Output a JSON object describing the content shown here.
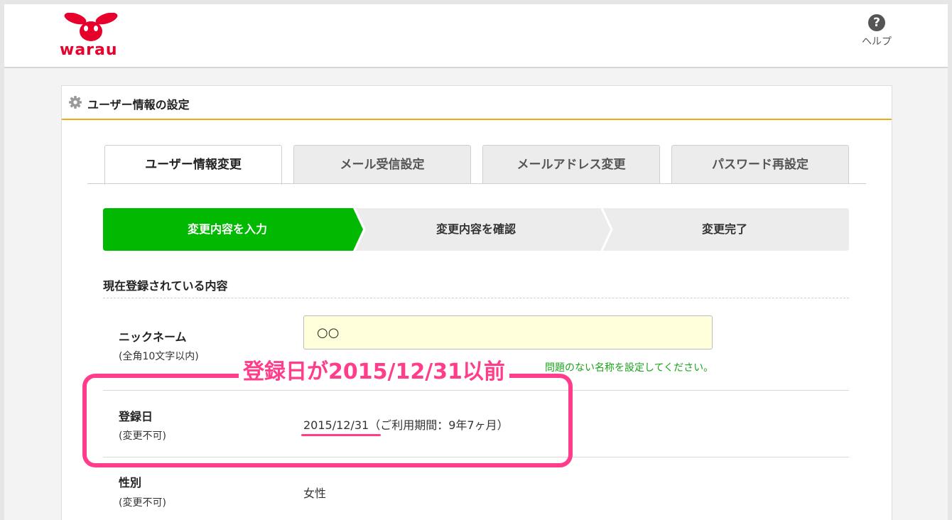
{
  "brand": {
    "name": "warau",
    "color": "#e8002d"
  },
  "help": {
    "icon": "question-icon",
    "label": "ヘルプ"
  },
  "panel": {
    "title": "ユーザー情報の設定",
    "icon": "gear-icon",
    "accent": "#f3a91b"
  },
  "tabs": [
    {
      "label": "ユーザー情報変更",
      "active": true
    },
    {
      "label": "メール受信設定",
      "active": false
    },
    {
      "label": "メールアドレス変更",
      "active": false
    },
    {
      "label": "パスワード再設定",
      "active": false
    }
  ],
  "steps": [
    {
      "label": "変更内容を入力",
      "active": true
    },
    {
      "label": "変更内容を確認",
      "active": false
    },
    {
      "label": "変更完了",
      "active": false
    }
  ],
  "step_active_color": "#00b900",
  "section": {
    "title": "現在登録されている内容"
  },
  "nickname": {
    "label": "ニックネーム",
    "sub": "(全角10文字以内)",
    "value": "○○",
    "note": "問題のない名称を設定してください。"
  },
  "registration": {
    "label": "登録日",
    "sub": "(変更不可)",
    "date": "2015/12/31",
    "period": "（ご利用期間：9年7ヶ月）"
  },
  "gender": {
    "label": "性別",
    "sub": "(変更不可)",
    "value": "女性"
  },
  "annotation": {
    "text": "登録日が2015/12/31以前",
    "color": "#ff3d8b"
  }
}
